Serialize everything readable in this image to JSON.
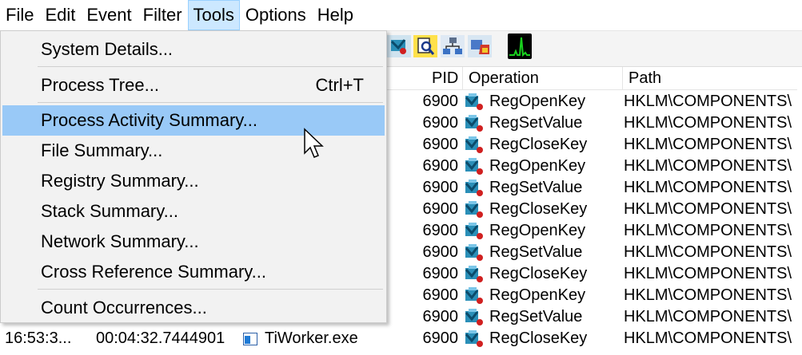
{
  "menubar": {
    "items": [
      {
        "label": "File"
      },
      {
        "label": "Edit"
      },
      {
        "label": "Event"
      },
      {
        "label": "Filter"
      },
      {
        "label": "Tools",
        "active": true
      },
      {
        "label": "Options"
      },
      {
        "label": "Help"
      }
    ]
  },
  "toolbar": {
    "icons": [
      "registry-activity-icon",
      "file-activity-icon",
      "network-activity-icon",
      "process-thread-activity-icon",
      "profiling-events-icon"
    ]
  },
  "table": {
    "columns": {
      "pid": "PID",
      "operation": "Operation",
      "path": "Path"
    },
    "rows": [
      {
        "pid": "6900",
        "operation": "RegOpenKey",
        "path": "HKLM\\COMPONENTS\\"
      },
      {
        "pid": "6900",
        "operation": "RegSetValue",
        "path": "HKLM\\COMPONENTS\\"
      },
      {
        "pid": "6900",
        "operation": "RegCloseKey",
        "path": "HKLM\\COMPONENTS\\"
      },
      {
        "pid": "6900",
        "operation": "RegOpenKey",
        "path": "HKLM\\COMPONENTS\\"
      },
      {
        "pid": "6900",
        "operation": "RegSetValue",
        "path": "HKLM\\COMPONENTS\\"
      },
      {
        "pid": "6900",
        "operation": "RegCloseKey",
        "path": "HKLM\\COMPONENTS\\"
      },
      {
        "pid": "6900",
        "operation": "RegOpenKey",
        "path": "HKLM\\COMPONENTS\\"
      },
      {
        "pid": "6900",
        "operation": "RegSetValue",
        "path": "HKLM\\COMPONENTS\\"
      },
      {
        "pid": "6900",
        "operation": "RegCloseKey",
        "path": "HKLM\\COMPONENTS\\"
      },
      {
        "pid": "6900",
        "operation": "RegOpenKey",
        "path": "HKLM\\COMPONENTS\\"
      },
      {
        "pid": "6900",
        "operation": "RegSetValue",
        "path": "HKLM\\COMPONENTS\\"
      }
    ],
    "last_row": {
      "time": "16:53:3...",
      "relative_time": "00:04:32.7444901",
      "process": "TiWorker.exe",
      "pid": "6900",
      "operation": "RegCloseKey",
      "path": "HKLM\\COMPONENTS\\"
    }
  },
  "tools_menu": {
    "items": [
      {
        "label": "System Details...",
        "shortcut": ""
      },
      {
        "label": "Process Tree...",
        "shortcut": "Ctrl+T"
      },
      {
        "label": "Process Activity Summary...",
        "shortcut": "",
        "highlighted": true
      },
      {
        "label": "File Summary...",
        "shortcut": ""
      },
      {
        "label": "Registry Summary...",
        "shortcut": ""
      },
      {
        "label": "Stack Summary...",
        "shortcut": ""
      },
      {
        "label": "Network Summary...",
        "shortcut": ""
      },
      {
        "label": "Cross Reference Summary...",
        "shortcut": ""
      },
      {
        "label": "Count Occurrences...",
        "shortcut": ""
      }
    ]
  },
  "colors": {
    "menu_active_bg": "#cce8ff",
    "menu_highlight_bg": "#99c9f7",
    "dropdown_bg": "#f2f2f2"
  }
}
